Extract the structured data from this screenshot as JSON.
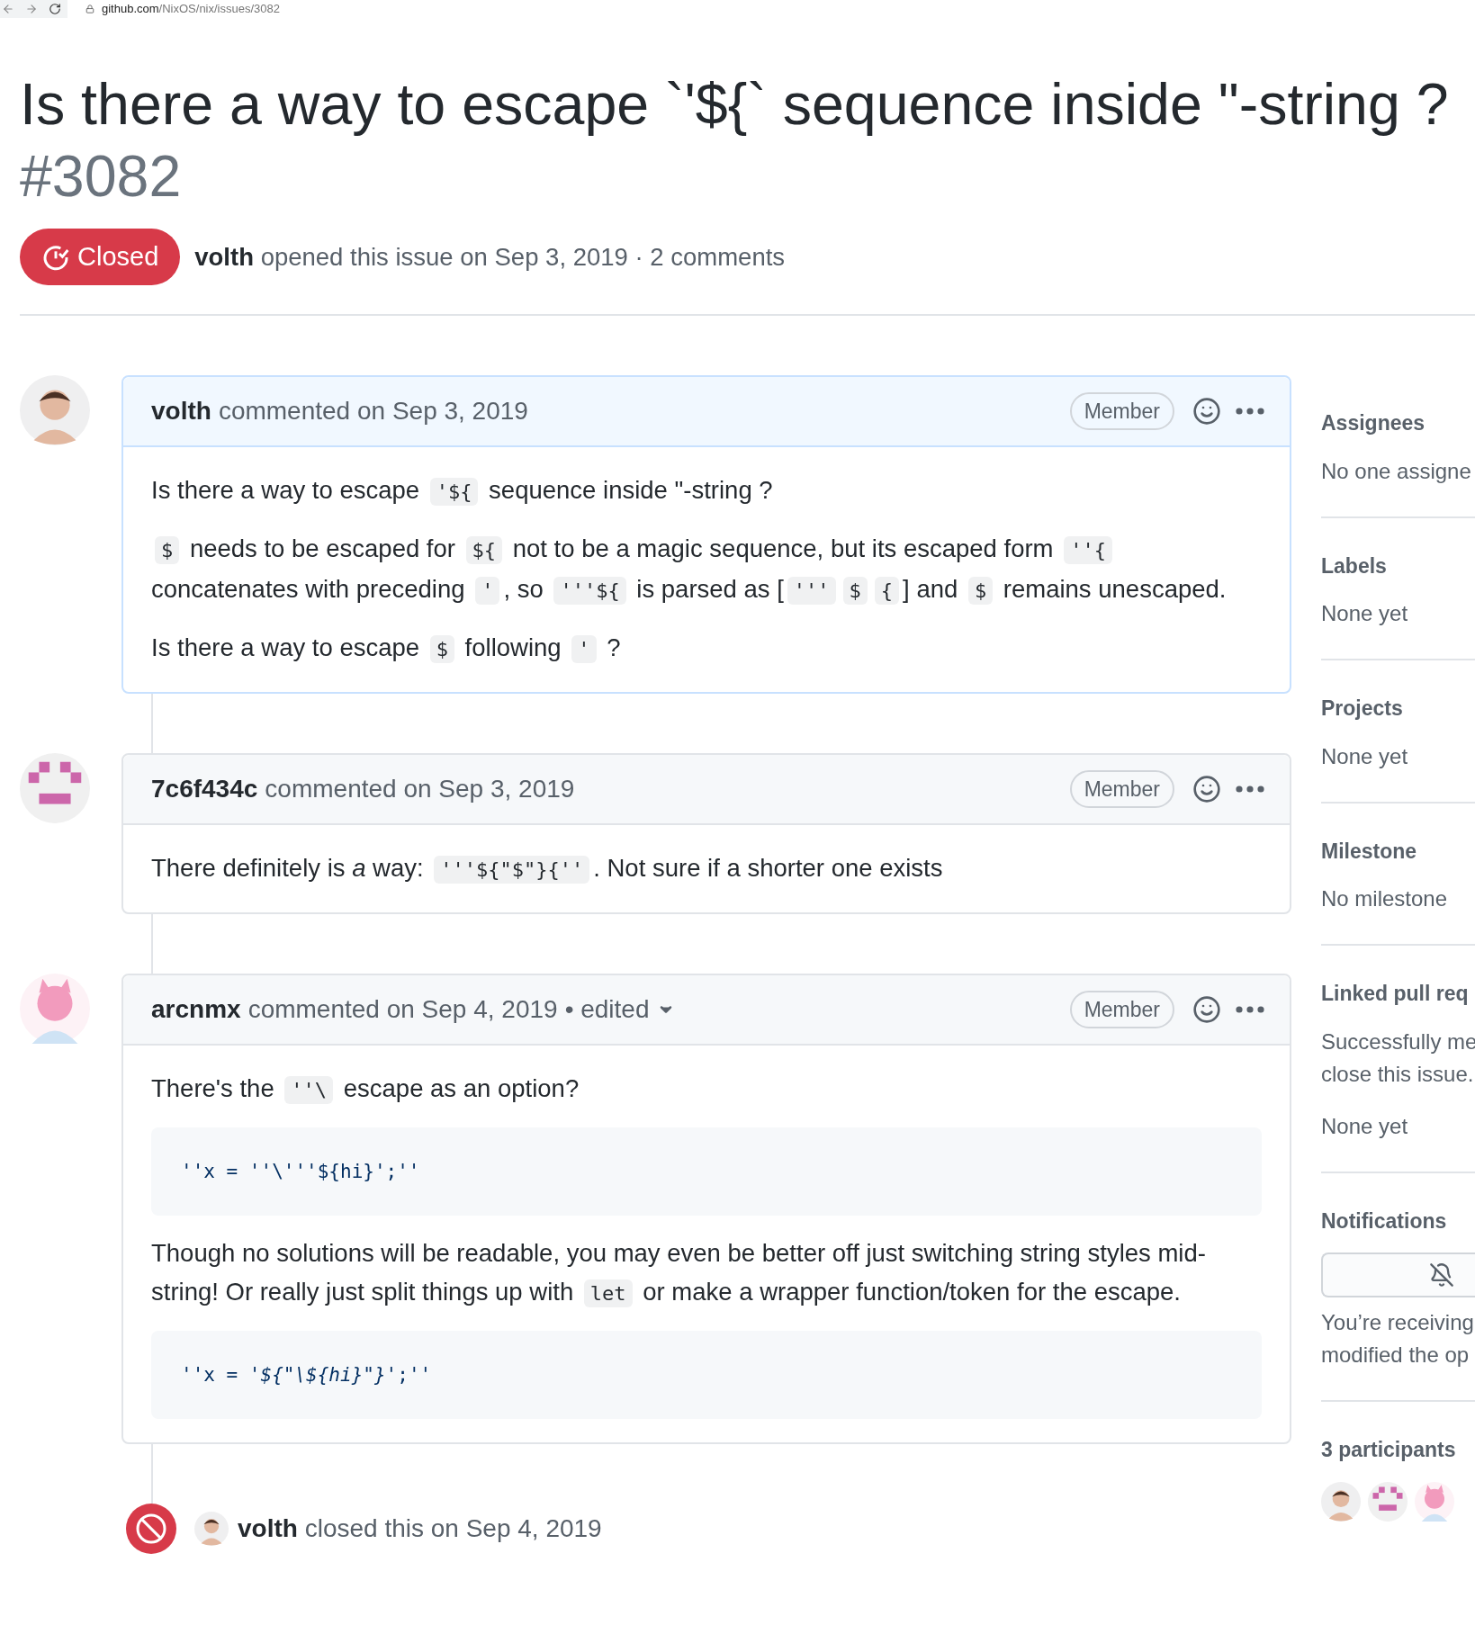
{
  "browser": {
    "host": "github.com",
    "path": "/NixOS/nix/issues/3082"
  },
  "issue": {
    "title": "Is there a way to escape `'${` sequence inside \"-string ?",
    "number": "#3082",
    "status": {
      "kind": "closed",
      "label": "Closed"
    },
    "author": "volth",
    "meta": "opened this issue on Sep 3, 2019 · 2 comments"
  },
  "comments": [
    {
      "avatar": {
        "kind": "photo"
      },
      "author": "volth",
      "action": "commented on Sep 3, 2019",
      "highlighted": true,
      "role": "Member",
      "blocks": [
        {
          "kind": "paragraph",
          "segments": [
            {
              "kind": "text",
              "text": "Is there a way to escape "
            },
            {
              "kind": "code",
              "text": "'${"
            },
            {
              "kind": "text",
              "text": " sequence inside \"-string ?"
            }
          ]
        },
        {
          "kind": "paragraph",
          "segments": [
            {
              "kind": "code",
              "text": "$"
            },
            {
              "kind": "text",
              "text": " needs to be escaped for "
            },
            {
              "kind": "code",
              "text": "${"
            },
            {
              "kind": "text",
              "text": " not to be a magic sequence, but its escaped form "
            },
            {
              "kind": "code",
              "text": "''{"
            },
            {
              "kind": "text",
              "text": " concatenates with preceding "
            },
            {
              "kind": "code",
              "text": "'"
            },
            {
              "kind": "text",
              "text": ", so "
            },
            {
              "kind": "code",
              "text": "'''${"
            },
            {
              "kind": "text",
              "text": " is parsed as ["
            },
            {
              "kind": "code",
              "text": "'''"
            },
            {
              "kind": "code",
              "text": "$"
            },
            {
              "kind": "code",
              "text": "{"
            },
            {
              "kind": "text",
              "text": "] and "
            },
            {
              "kind": "code",
              "text": "$"
            },
            {
              "kind": "text",
              "text": " remains unescaped."
            }
          ]
        },
        {
          "kind": "paragraph",
          "segments": [
            {
              "kind": "text",
              "text": "Is there a way to escape "
            },
            {
              "kind": "code",
              "text": "$"
            },
            {
              "kind": "text",
              "text": " following "
            },
            {
              "kind": "code",
              "text": "'"
            },
            {
              "kind": "text",
              "text": " ?"
            }
          ]
        }
      ]
    },
    {
      "avatar": {
        "kind": "identicon"
      },
      "author": "7c6f434c",
      "action": "commented on Sep 3, 2019",
      "highlighted": false,
      "role": "Member",
      "blocks": [
        {
          "kind": "paragraph",
          "segments": [
            {
              "kind": "text",
              "text": "There definitely is "
            },
            {
              "kind": "em",
              "text": "a"
            },
            {
              "kind": "text",
              "text": " way: "
            },
            {
              "kind": "code",
              "text": "'''${\"$\"}{''"
            },
            {
              "kind": "text",
              "text": ". Not sure if a shorter one exists"
            }
          ]
        }
      ]
    },
    {
      "avatar": {
        "kind": "character"
      },
      "author": "arcnmx",
      "action": "commented on Sep 4, 2019",
      "edited": "• edited",
      "highlighted": false,
      "role": "Member",
      "blocks": [
        {
          "kind": "paragraph",
          "segments": [
            {
              "kind": "text",
              "text": "There's the "
            },
            {
              "kind": "code",
              "text": "''\\"
            },
            {
              "kind": "text",
              "text": " escape as an option?"
            }
          ]
        },
        {
          "kind": "codeblock",
          "segments": [
            {
              "kind": "text",
              "text": "''x = ''\\'''${hi}';''"
            }
          ]
        },
        {
          "kind": "paragraph",
          "segments": [
            {
              "kind": "text",
              "text": "Though no solutions will be readable, you may even be better off just switching string styles mid-string! Or really just split things up with "
            },
            {
              "kind": "code",
              "text": "let"
            },
            {
              "kind": "text",
              "text": " or make a wrapper function/token for the escape."
            }
          ]
        },
        {
          "kind": "codeblock",
          "segments": [
            {
              "kind": "text",
              "text": "''x = '"
            },
            {
              "kind": "em",
              "text": "${\"\\${hi}\"}"
            },
            {
              "kind": "text",
              "text": "';''"
            }
          ]
        }
      ]
    }
  ],
  "event": {
    "kind": "closed",
    "avatar": {
      "kind": "photo"
    },
    "actor": "volth",
    "text": "closed this on Sep 4, 2019"
  },
  "sidebar": [
    {
      "kind": "text",
      "heading": "Assignees",
      "lines": [
        "No one assigne"
      ]
    },
    {
      "kind": "text",
      "heading": "Labels",
      "lines": [
        "None yet"
      ]
    },
    {
      "kind": "text",
      "heading": "Projects",
      "lines": [
        "None yet"
      ]
    },
    {
      "kind": "text",
      "heading": "Milestone",
      "lines": [
        "No milestone"
      ]
    },
    {
      "kind": "linked",
      "heading": "Linked pull req",
      "lines": [
        "Successfully me",
        "close this issue."
      ],
      "value": "None yet"
    },
    {
      "kind": "notifications",
      "heading": "Notifications",
      "lines": [
        "You’re receiving",
        "modified the op"
      ]
    },
    {
      "kind": "participants",
      "heading": "3 participants",
      "avatars": [
        {
          "kind": "photo"
        },
        {
          "kind": "identicon"
        },
        {
          "kind": "character"
        }
      ]
    }
  ]
}
